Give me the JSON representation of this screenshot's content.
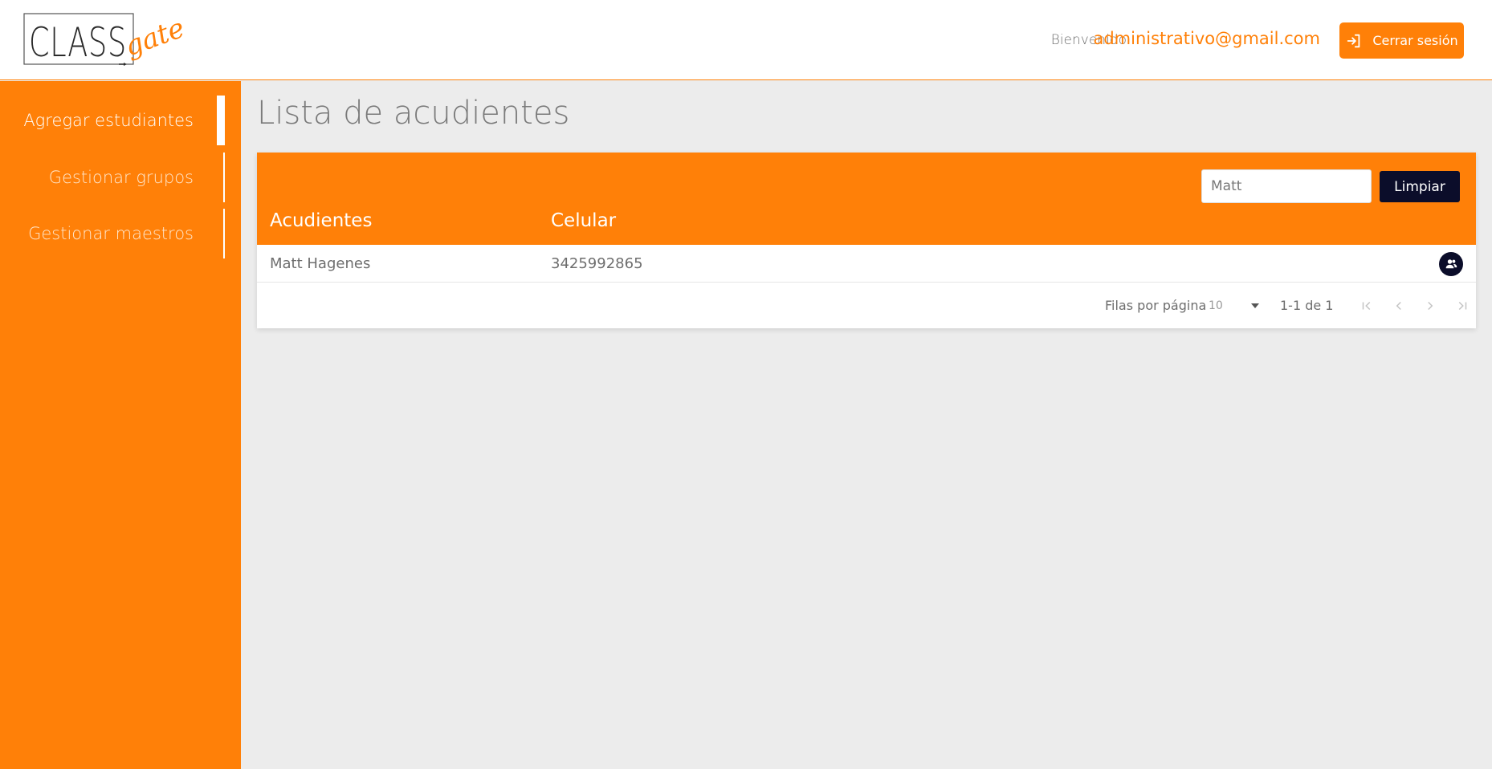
{
  "header": {
    "logo_text": "CLASS",
    "logo_script": "gate",
    "welcome_label": "Bienvenido",
    "user_email": "administrativo@gmail.com",
    "logout_label": "Cerrar sesión"
  },
  "sidebar": {
    "items": [
      {
        "label": "Agregar estudiantes",
        "active": true
      },
      {
        "label": "Gestionar grupos",
        "active": false
      },
      {
        "label": "Gestionar maestros",
        "active": false
      }
    ]
  },
  "main": {
    "title": "Lista de acudientes",
    "search": {
      "value": "Matt"
    },
    "clear_label": "Limpiar",
    "columns": [
      "Acudientes",
      "Celular"
    ],
    "rows": [
      {
        "name": "Matt Hagenes",
        "phone": "3425992865",
        "action_icon": "account-group-icon"
      }
    ],
    "pagination": {
      "rows_per_page_label": "Filas por página",
      "rows_per_page_value": "10",
      "range_text": "1-1 de 1"
    }
  },
  "colors": {
    "accent": "#ff8008",
    "dark": "#0b0d2a",
    "background": "#ececec"
  }
}
